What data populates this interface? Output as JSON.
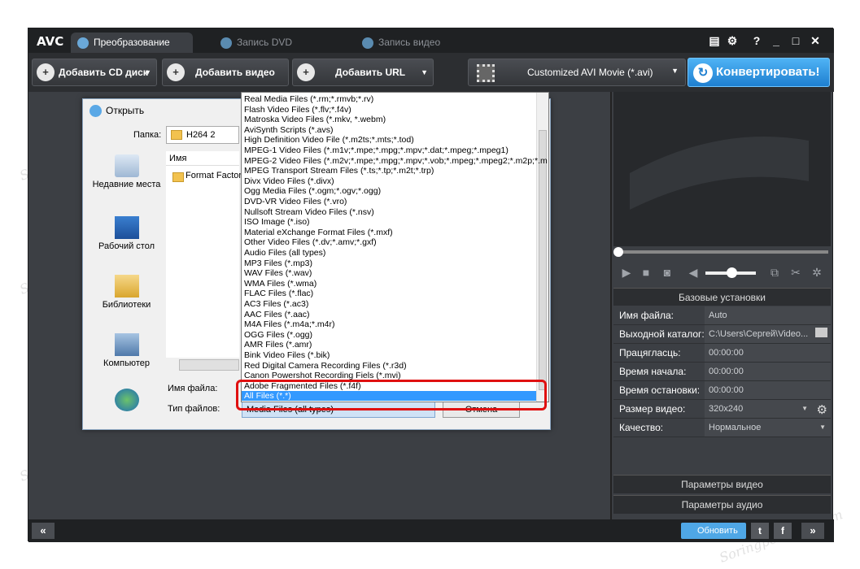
{
  "app": {
    "logo": "AVC",
    "tabs": [
      {
        "label": "Преобразование",
        "active": true
      },
      {
        "label": "Запись DVD",
        "active": false
      },
      {
        "label": "Запись видео",
        "active": false
      }
    ],
    "window_controls": {
      "help": "?"
    }
  },
  "toolbar": {
    "add_cd": "Добавить CD диск",
    "add_video": "Добавить видео",
    "add_url": "Добавить URL",
    "profile": "Customized AVI Movie (*.avi)",
    "convert": "Конвертировать!"
  },
  "dialog": {
    "title": "Открыть",
    "look_in_label": "Папка:",
    "look_in_value": "H264 2",
    "column_name": "Имя",
    "list_item": "Format Factory",
    "places": [
      "Недавние места",
      "Рабочий стол",
      "Библиотеки",
      "Компьютер"
    ],
    "filename_label": "Имя файла:",
    "filetype_label": "Тип файлов:",
    "filetype_value": "Media Files (all types)",
    "cancel": "Отмена"
  },
  "filetypes": [
    "Real Media Files (*.rm;*.rmvb;*.rv)",
    "Flash Video Files (*.flv;*.f4v)",
    "Matroska Video Files (*.mkv, *.webm)",
    "AviSynth Scripts (*.avs)",
    "High Definition Video File (*.m2ts;*.mts;*.tod)",
    "MPEG-1 Video Files (*.m1v;*.mpe;*.mpg;*.mpv;*.dat;*.mpeg;*.mpeg1)",
    "MPEG-2 Video Files (*.m2v;*.mpe;*.mpg;*.mpv;*.vob;*.mpeg;*.mpeg2;*.m2p;*.m",
    "MPEG Transport Stream Files (*.ts;*.tp;*.m2t;*.trp)",
    "Divx Video Files (*.divx)",
    "Ogg Media Files (*.ogm;*.ogv;*.ogg)",
    "DVD-VR Video Files (*.vro)",
    "Nullsoft Stream Video Files (*.nsv)",
    "ISO Image (*.iso)",
    "Material eXchange Format Files (*.mxf)",
    "Other Video Files (*.dv;*.amv;*.gxf)",
    "Audio Files (all types)",
    "MP3 Files (*.mp3)",
    "WAV Files (*.wav)",
    "WMA Files (*.wma)",
    "FLAC Files (*.flac)",
    "AC3 Files (*.ac3)",
    "AAC Files (*.aac)",
    "M4A Files (*.m4a;*.m4r)",
    "OGG Files (*.ogg)",
    "AMR Files (*.amr)",
    "Bink Video Files (*.bik)",
    "Red Digital Camera Recording Files (*.r3d)",
    "Canon Powershot Recording Fiels (*.mvi)",
    "Adobe Fragmented Files (*.f4f)",
    "All Files (*.*)"
  ],
  "selected_filetype": "All Files (*.*)",
  "settings": {
    "header": "Базовые установки",
    "rows": [
      {
        "key": "Имя файла:",
        "value": "Auto"
      },
      {
        "key": "Выходной каталог:",
        "value": "C:\\Users\\Сергей\\Video..."
      },
      {
        "key": "Працягласць:",
        "value": "00:00:00"
      },
      {
        "key": "Время начала:",
        "value": "00:00:00"
      },
      {
        "key": "Время остановки:",
        "value": "00:00:00"
      },
      {
        "key": "Размер видео:",
        "value": "320x240"
      },
      {
        "key": "Качество:",
        "value": "Нормальное"
      }
    ],
    "video_params": "Параметры видео",
    "audio_params": "Параметры аудио"
  },
  "statusbar": {
    "update": "Обновить",
    "prev": "«",
    "next": "»",
    "twitter": "t",
    "facebook": "f"
  },
  "watermark": "Soringpcrepair.com",
  "colors": {
    "accent": "#1e7fd0",
    "selection": "#3399ff",
    "highlight": "#e01010"
  }
}
